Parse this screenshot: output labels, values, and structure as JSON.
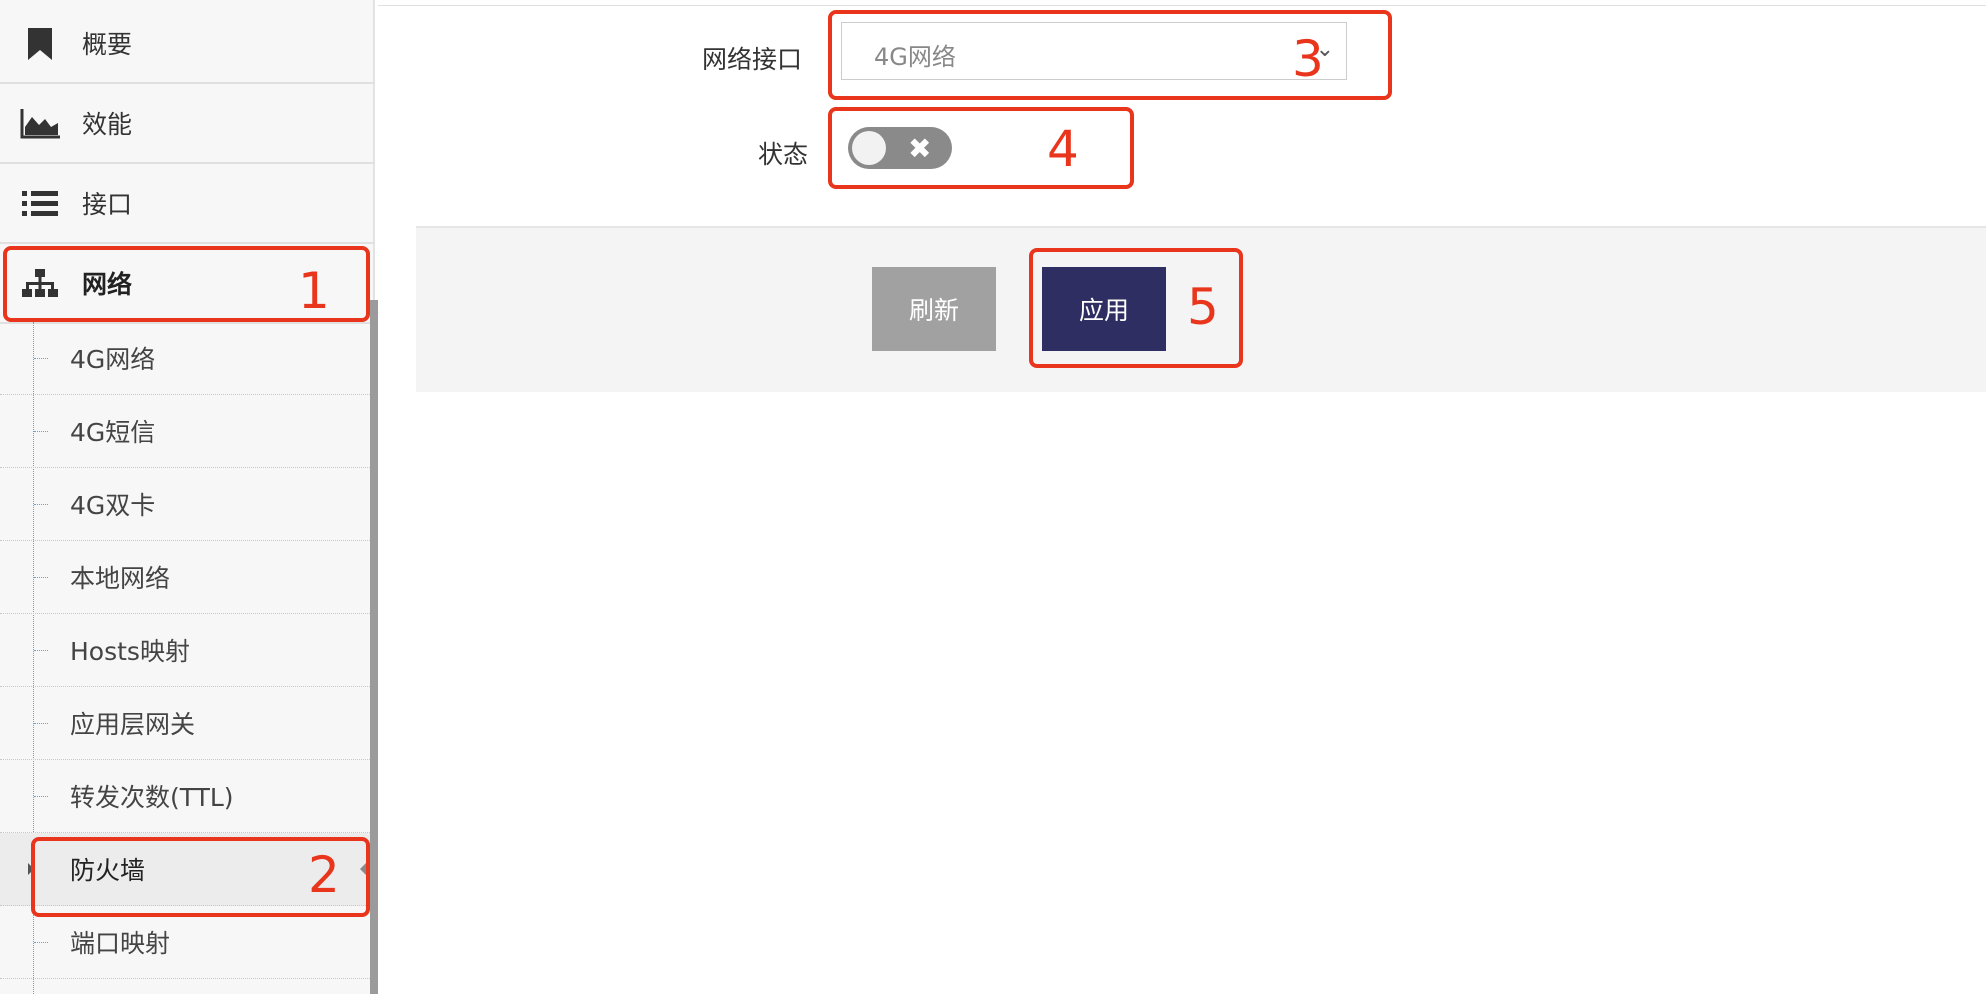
{
  "sidebar": {
    "items": [
      {
        "label": "概要",
        "icon": "bookmark-icon"
      },
      {
        "label": "效能",
        "icon": "area-chart-icon"
      },
      {
        "label": "接口",
        "icon": "list-icon"
      },
      {
        "label": "网络",
        "icon": "sitemap-icon"
      }
    ],
    "subitems": [
      {
        "label": "4G网络"
      },
      {
        "label": "4G短信"
      },
      {
        "label": "4G双卡"
      },
      {
        "label": "本地网络"
      },
      {
        "label": "Hosts映射"
      },
      {
        "label": "应用层网关"
      },
      {
        "label": "转发次数(TTL)"
      },
      {
        "label": "防火墙"
      },
      {
        "label": "端口映射"
      }
    ]
  },
  "form": {
    "interface_label": "网络接口",
    "interface_value": "4G网络",
    "status_label": "状态",
    "status_on": false
  },
  "buttons": {
    "refresh": "刷新",
    "apply": "应用"
  },
  "annotations": [
    "1",
    "2",
    "3",
    "4",
    "5"
  ],
  "colors": {
    "annotation": "#e8351c",
    "apply_button": "#2f2e63",
    "refresh_button": "#a1a1a1"
  }
}
